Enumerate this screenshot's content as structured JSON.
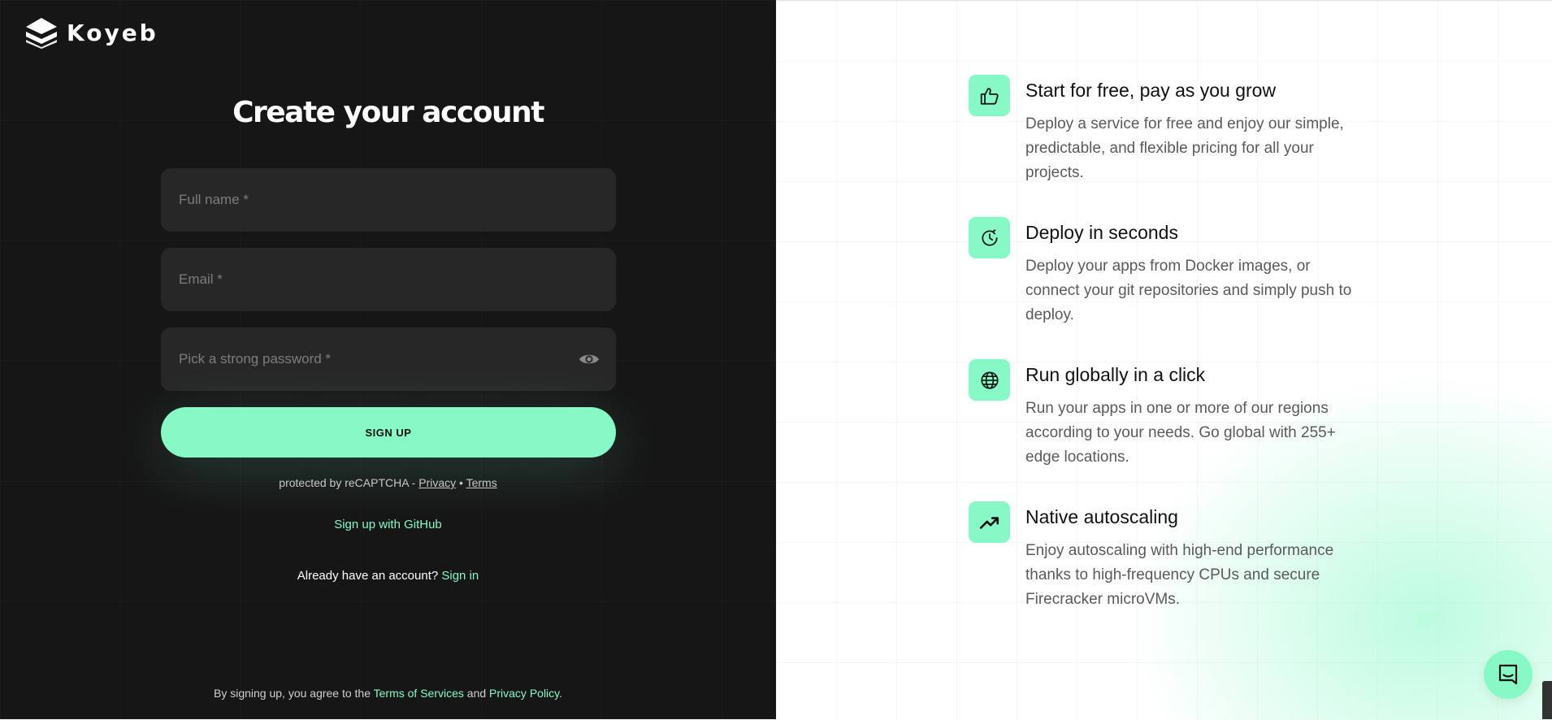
{
  "brand": {
    "name": "Koyeb",
    "logo_icon": "koyeb-logo-icon"
  },
  "form": {
    "title": "Create your account",
    "full_name_placeholder": "Full name *",
    "email_placeholder": "Email *",
    "password_placeholder": "Pick a strong password *",
    "password_toggle_icon": "eye-icon",
    "signup_label": "SIGN UP",
    "recaptcha": {
      "prefix": "protected by reCAPTCHA - ",
      "privacy": "Privacy",
      "separator": " • ",
      "terms": "Terms"
    },
    "github_label": "Sign up with GitHub",
    "already_text": "Already have an account? ",
    "signin_label": "Sign in",
    "legal": {
      "prefix": "By signing up, you agree to the ",
      "terms_link": "Terms of Services",
      "middle": " and ",
      "privacy_link": "Privacy Policy",
      "suffix": "."
    }
  },
  "features": [
    {
      "icon": "thumbs-up-icon",
      "title": "Start for free, pay as you grow",
      "description": "Deploy a service for free and enjoy our simple, predictable, and flexible pricing for all your projects."
    },
    {
      "icon": "clock-refresh-icon",
      "title": "Deploy in seconds",
      "description": "Deploy your apps from Docker images, or connect your git repositories and simply push to deploy."
    },
    {
      "icon": "globe-icon",
      "title": "Run globally in a click",
      "description": "Run your apps in one or more of our regions according to your needs. Go global with 255+ edge locations."
    },
    {
      "icon": "trending-up-icon",
      "title": "Native autoscaling",
      "description": "Enjoy autoscaling with high-end performance thanks to high-frequency CPUs and secure Firecracker microVMs."
    }
  ],
  "chat_icon": "chat-bubble-icon",
  "colors": {
    "accent": "#86f9c6",
    "dark_bg": "#161616",
    "field_bg": "#272727"
  }
}
